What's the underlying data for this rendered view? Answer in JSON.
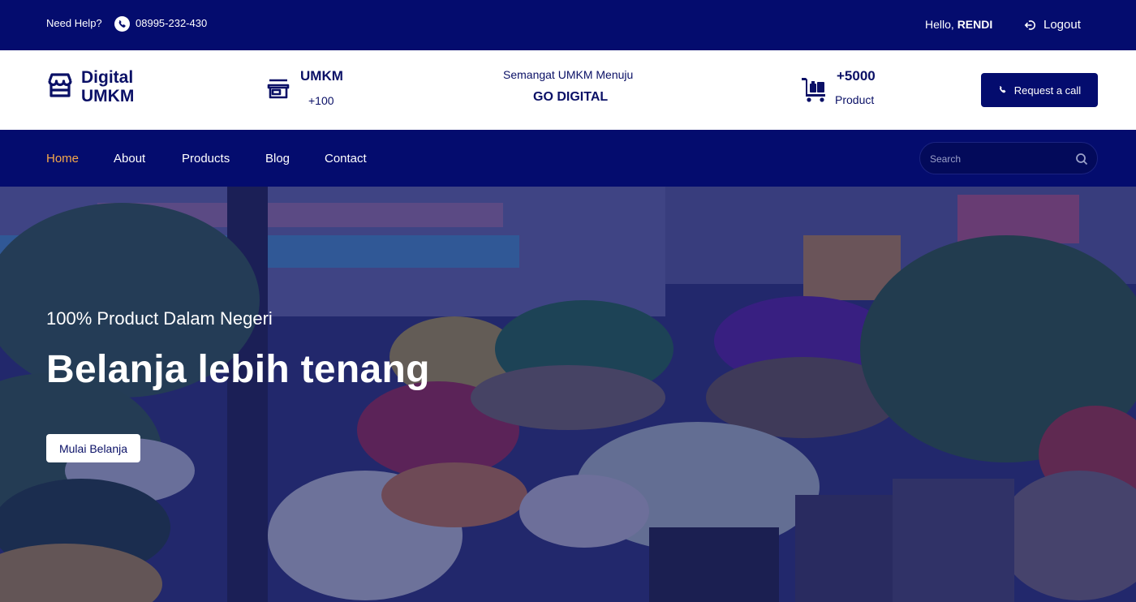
{
  "topbar": {
    "help_label": "Need Help?",
    "phone": "08995-232-430",
    "hello_prefix": "Hello, ",
    "username": "RENDI",
    "logout_label": "Logout"
  },
  "infobar": {
    "brand_line1": "Digital",
    "brand_line2": "UMKM",
    "umkm_title": "UMKM",
    "umkm_count": "+100",
    "tagline_line1": "Semangat UMKM Menuju",
    "tagline_line2": "GO DIGITAL",
    "product_count": "+5000",
    "product_label": "Product",
    "request_call_label": "Request a call"
  },
  "nav": {
    "items": [
      {
        "label": "Home",
        "active": true
      },
      {
        "label": "About",
        "active": false
      },
      {
        "label": "Products",
        "active": false
      },
      {
        "label": "Blog",
        "active": false
      },
      {
        "label": "Contact",
        "active": false
      }
    ],
    "search_placeholder": "Search"
  },
  "hero": {
    "subtitle": "100% Product Dalam Negeri",
    "title": "Belanja lebih tenang",
    "cta_label": "Mulai Belanja"
  },
  "colors": {
    "primary": "#040c6e",
    "accent": "#f5a84a",
    "text_dark": "#0a1066"
  }
}
